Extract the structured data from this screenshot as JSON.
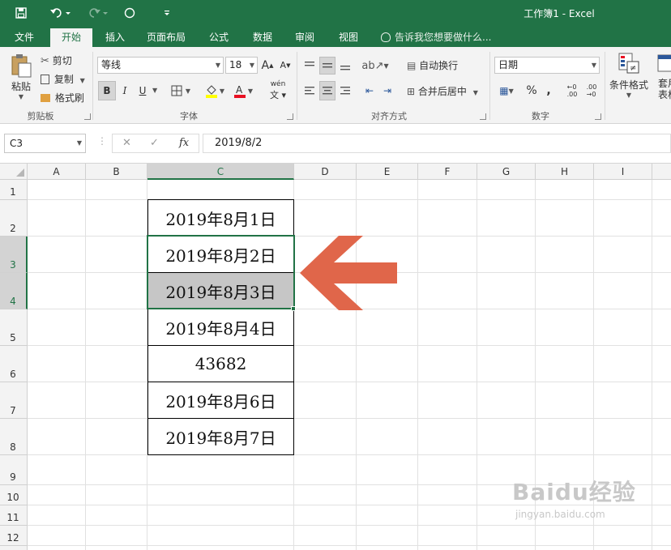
{
  "window": {
    "title": "工作簿1 - Excel"
  },
  "quick_access": {
    "save_icon": "save-icon",
    "undo_icon": "undo-icon",
    "redo_icon": "redo-icon",
    "touch_icon": "circle-icon",
    "customize_icon": "customize-icon"
  },
  "tabs": [
    "文件",
    "开始",
    "插入",
    "页面布局",
    "公式",
    "数据",
    "审阅",
    "视图"
  ],
  "tell_me": "告诉我您想要做什么...",
  "ribbon": {
    "clipboard": {
      "paste": "粘贴",
      "cut": "剪切",
      "copy": "复制",
      "format_painter": "格式刷",
      "group": "剪贴板"
    },
    "font": {
      "name": "等线",
      "size": "18",
      "bold": "B",
      "italic": "I",
      "underline": "U",
      "group": "字体",
      "grow": "A",
      "shrink": "A",
      "phonetic": "wén",
      "font_color_accent": "#e81123",
      "fill_color_accent": "#ffff00"
    },
    "alignment": {
      "wrap": "自动换行",
      "merge": "合并后居中",
      "group": "对齐方式"
    },
    "number": {
      "format": "日期",
      "percent": "%",
      "comma": ",",
      "group": "数字"
    },
    "styles": {
      "conditional": "条件格式",
      "table": "套用表格"
    }
  },
  "formula_bar": {
    "name_box": "C3",
    "formula": "2019/8/2",
    "fx": "fx"
  },
  "columns": [
    "A",
    "B",
    "C",
    "D",
    "E",
    "F",
    "G",
    "H",
    "I"
  ],
  "selected_column": "C",
  "rows": [
    "1",
    "2",
    "3",
    "4",
    "5",
    "6",
    "7",
    "8",
    "9",
    "10",
    "11",
    "12"
  ],
  "selected_rows": [
    "3",
    "4"
  ],
  "cells": [
    {
      "ref": "C2",
      "value": "2019年8月1日"
    },
    {
      "ref": "C3",
      "value": "2019年8月2日"
    },
    {
      "ref": "C4",
      "value": "2019年8月3日"
    },
    {
      "ref": "C5",
      "value": "2019年8月4日"
    },
    {
      "ref": "C6",
      "value": "43682"
    },
    {
      "ref": "C7",
      "value": "2019年8月6日"
    },
    {
      "ref": "C8",
      "value": "2019年8月7日"
    }
  ],
  "arrow_color": "#e0664a",
  "accent": "#217346",
  "watermark": {
    "brand": "Baidu经验",
    "url": "jingyan.baidu.com"
  }
}
